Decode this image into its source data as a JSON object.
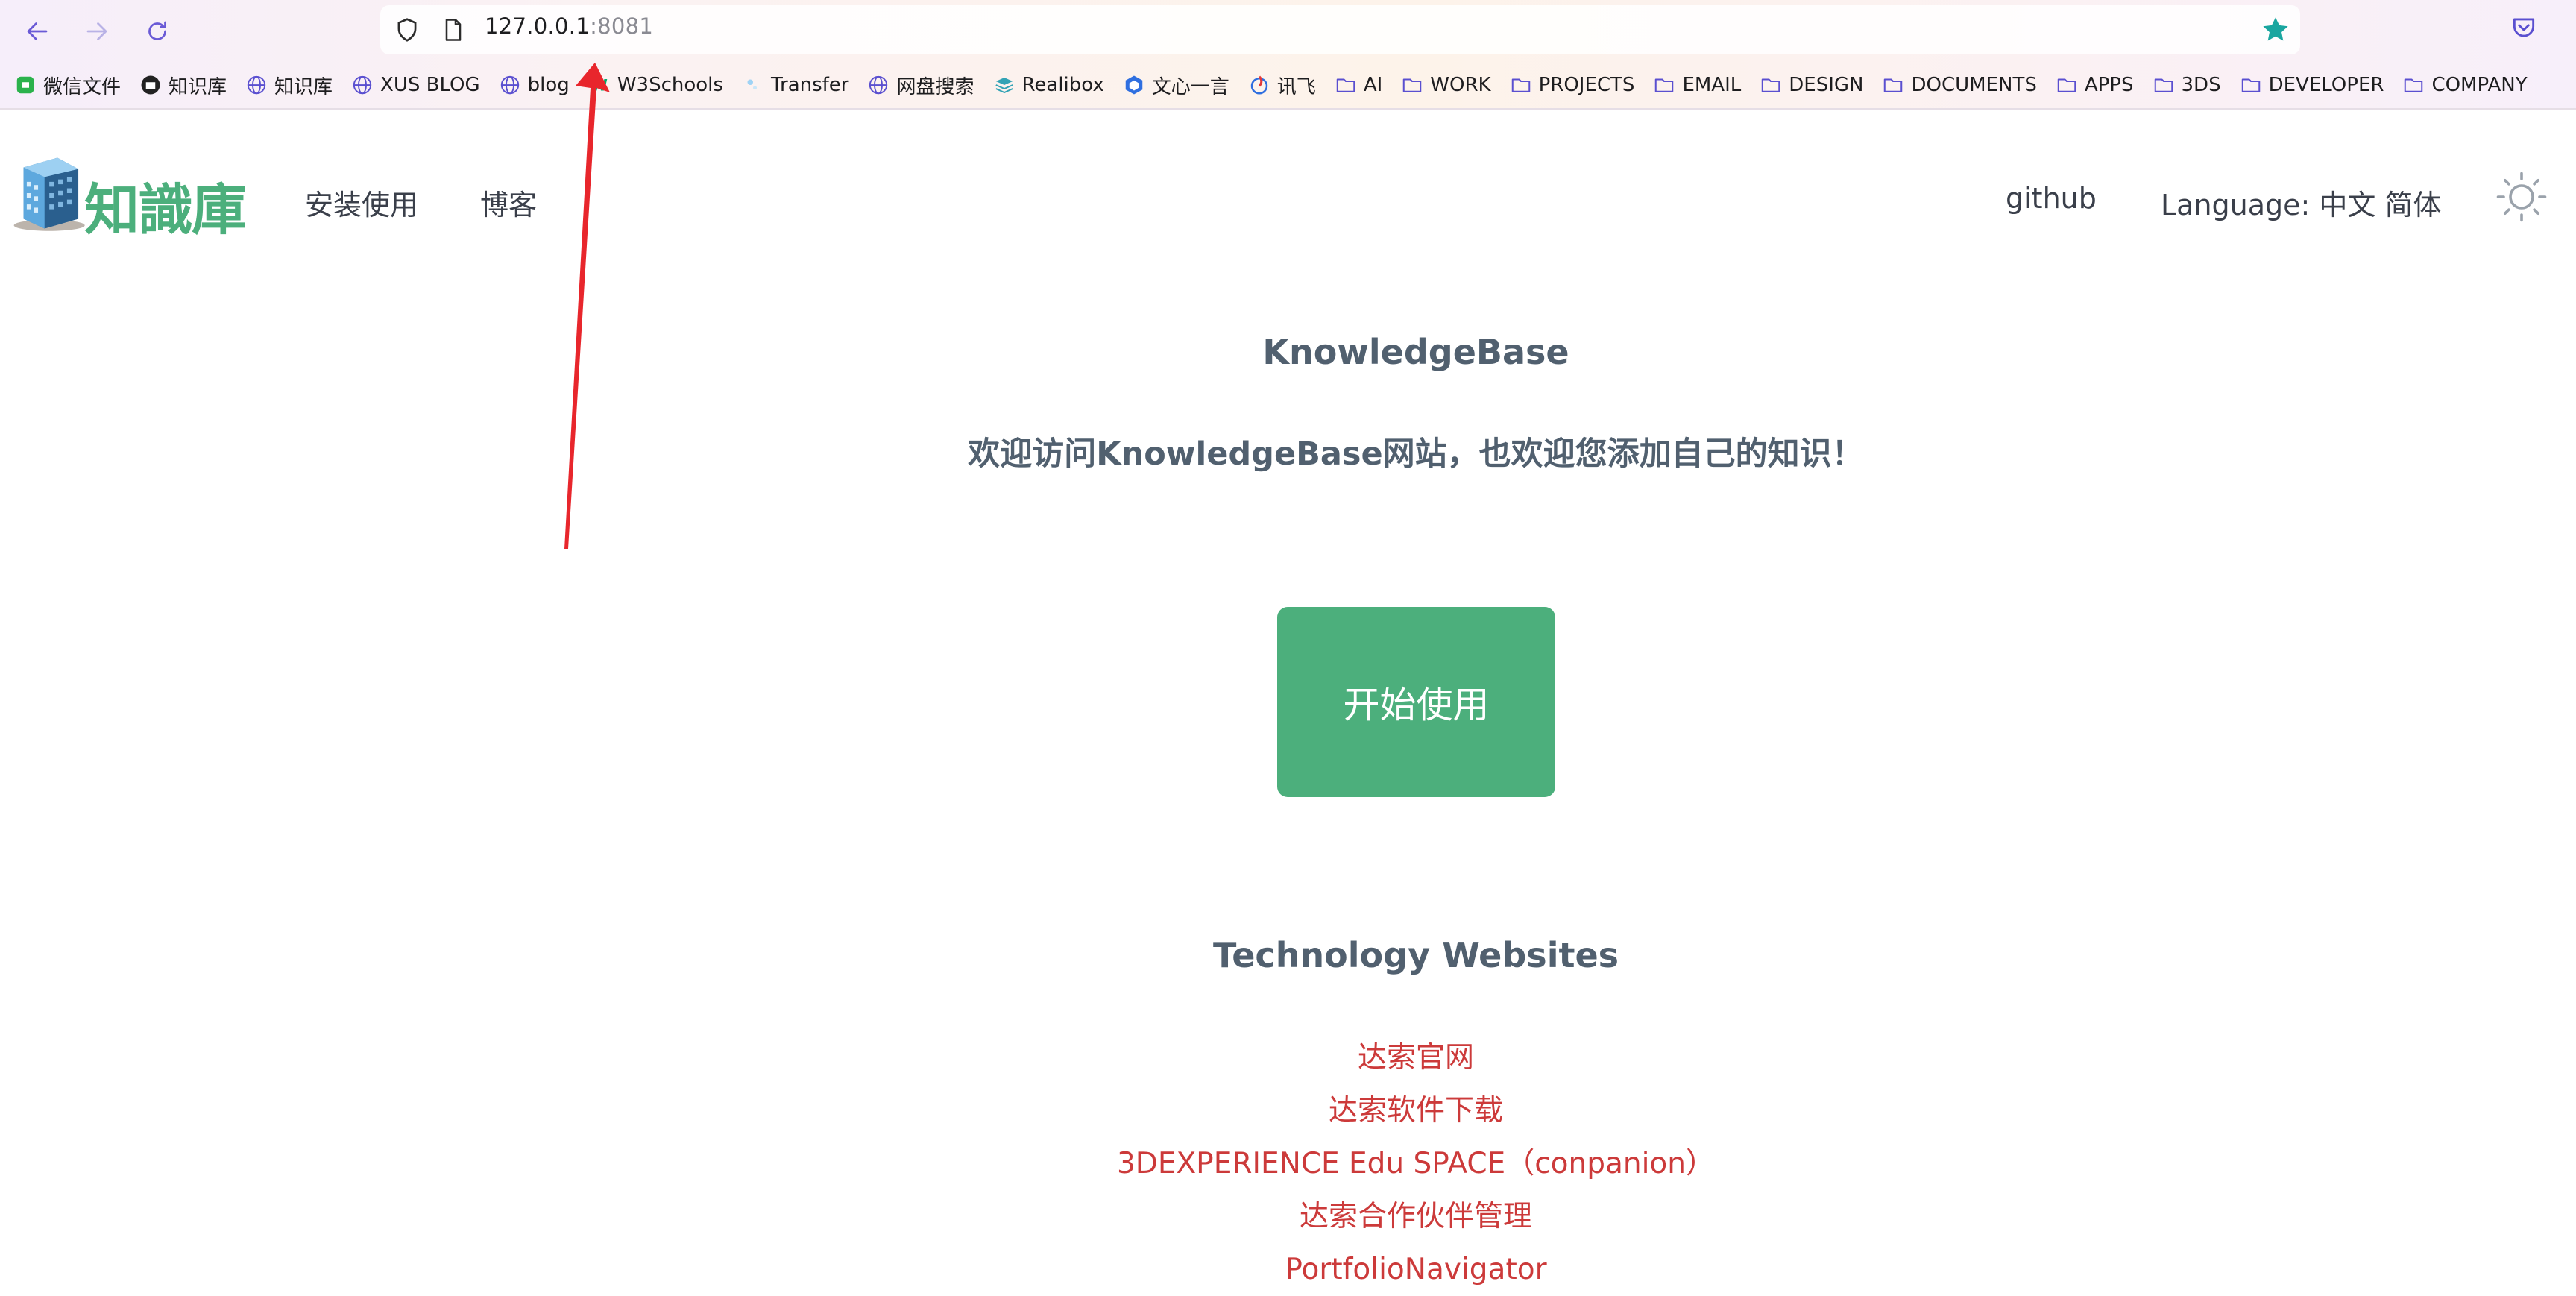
{
  "browser": {
    "url_host": "127.0.0.1",
    "url_port": ":8081",
    "bookmarks": [
      {
        "label": "微信文件",
        "icon": "wechat-files-icon"
      },
      {
        "label": "知识库",
        "icon": "knowledge-base-logo-icon"
      },
      {
        "label": "知识库",
        "icon": "globe-icon"
      },
      {
        "label": "XUS BLOG",
        "icon": "globe-icon"
      },
      {
        "label": "blog",
        "icon": "globe-icon"
      },
      {
        "label": "W3Schools",
        "icon": "w3schools-icon"
      },
      {
        "label": "Transfer",
        "icon": "transfer-icon"
      },
      {
        "label": "网盘搜索",
        "icon": "globe-icon"
      },
      {
        "label": "Realibox",
        "icon": "realibox-icon"
      },
      {
        "label": "文心一言",
        "icon": "wenxin-icon"
      },
      {
        "label": "讯飞",
        "icon": "xunfei-icon"
      },
      {
        "label": "AI",
        "icon": "folder-icon"
      },
      {
        "label": "WORK",
        "icon": "folder-icon"
      },
      {
        "label": "PROJECTS",
        "icon": "folder-icon"
      },
      {
        "label": "EMAIL",
        "icon": "folder-icon"
      },
      {
        "label": "DESIGN",
        "icon": "folder-icon"
      },
      {
        "label": "DOCUMENTS",
        "icon": "folder-icon"
      },
      {
        "label": "APPS",
        "icon": "folder-icon"
      },
      {
        "label": "3DS",
        "icon": "folder-icon"
      },
      {
        "label": "DEVELOPER",
        "icon": "folder-icon"
      },
      {
        "label": "COMPANY",
        "icon": "folder-icon"
      }
    ]
  },
  "site": {
    "brand": "知識庫",
    "nav": {
      "install": "安装使用",
      "blog": "博客",
      "github": "github",
      "language": "Language: 中文 简体"
    }
  },
  "main": {
    "title": "KnowledgeBase",
    "welcome": "欢迎访问KnowledgeBase网站，也欢迎您添加自己的知识！",
    "start_button": "开始使用",
    "tech_title": "Technology Websites",
    "links": [
      "达索官网",
      "达索软件下载",
      "3DEXPERIENCE Edu SPACE（conpanion）",
      "达索合作伙伴管理",
      "PortfolioNavigator"
    ]
  },
  "colors": {
    "brand_green": "#4caf7c",
    "link_red": "#cc3a3a",
    "heading_gray": "#51606f",
    "annotation_red": "#e8262c",
    "bookmark_star": "#1aa6a0"
  }
}
